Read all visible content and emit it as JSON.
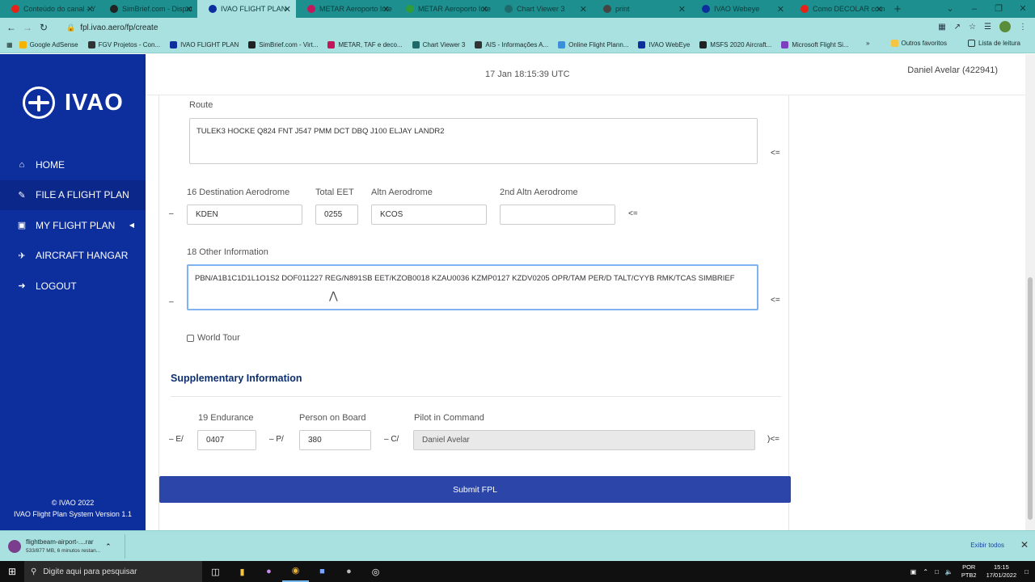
{
  "browser": {
    "tabs": [
      {
        "title": "Conteúdo do canal - Y",
        "color": "#e62117"
      },
      {
        "title": "SimBrief.com - Dispat",
        "color": "#222222"
      },
      {
        "title": "IVAO FLIGHT PLAN",
        "color": "#0d2f9e"
      },
      {
        "title": "METAR Aeroporto Inte",
        "color": "#c2185b"
      },
      {
        "title": "METAR Aeroporto Inte",
        "color": "#2e9d3a"
      },
      {
        "title": "Chart Viewer 3",
        "color": "#1e6a6a"
      },
      {
        "title": "print",
        "color": "#444444"
      },
      {
        "title": "IVAO Webeye",
        "color": "#0d2f9e"
      },
      {
        "title": "Como DECOLAR com",
        "color": "#e62117"
      }
    ],
    "url": "fpl.ivao.aero/fp/create",
    "bookmarks": [
      {
        "label": "Google AdSense",
        "color": "#f4b400"
      },
      {
        "label": "FGV Projetos - Con...",
        "color": "#333333"
      },
      {
        "label": "IVAO FLIGHT PLAN",
        "color": "#0d2f9e"
      },
      {
        "label": "SimBrief.com - Virt...",
        "color": "#222222"
      },
      {
        "label": "METAR, TAF e deco...",
        "color": "#c2185b"
      },
      {
        "label": "Chart Viewer 3",
        "color": "#1e6a6a"
      },
      {
        "label": "AIS - Informações A...",
        "color": "#333333"
      },
      {
        "label": "Online Flight Plann...",
        "color": "#3a8fd8"
      },
      {
        "label": "IVAO WebEye",
        "color": "#0d2f9e"
      },
      {
        "label": "MSFS 2020 Aircraft...",
        "color": "#222222"
      },
      {
        "label": "Microsoft Flight Si...",
        "color": "#7b3fbf"
      }
    ],
    "other_favorites": "Outros favoritos",
    "reading_list": "Lista de leitura"
  },
  "sidebar": {
    "logo_text": "IVAO",
    "items": [
      {
        "label": "HOME",
        "icon": "home-icon"
      },
      {
        "label": "FILE A FLIGHT PLAN",
        "icon": "pencil-icon"
      },
      {
        "label": "MY FLIGHT PLAN",
        "icon": "document-icon"
      },
      {
        "label": "AIRCRAFT HANGAR",
        "icon": "plane-icon"
      },
      {
        "label": "LOGOUT",
        "icon": "logout-icon"
      }
    ],
    "footer_line1": "© IVAO 2022",
    "footer_line2": "IVAO Flight Plan System Version 1.1"
  },
  "header": {
    "clock": "17 Jan 18:15:39 UTC",
    "user": "Daniel Avelar (422941)"
  },
  "form": {
    "route_label": "Route",
    "route_value": "TULEK3 HOCKE Q824 FNT J547 PMM DCT DBQ J100 ELJAY LANDR2",
    "route_arrow": "<=",
    "dest_label": "16 Destination Aerodrome",
    "dest_value": "KDEN",
    "eet_label": "Total EET",
    "eet_value": "0255",
    "altn_label": "Altn Aerodrome",
    "altn_value": "KCOS",
    "altn2_label": "2nd Altn Aerodrome",
    "altn2_value": "",
    "dest_prefix": "–",
    "dest_arrow": "<=",
    "other_label": "18 Other Information",
    "other_value": "PBN/A1B1C1D1L1O1S2 DOF011227 REG/N891SB EET/KZOB0018 KZAU0036 KZMP0127 KZDV0205 OPR/TAM PER/D TALT/CYYB RMK/TCAS SIMBRIEF",
    "other_prefix": "–",
    "other_arrow": "<=",
    "world_tour_label": "World Tour",
    "supp_title": "Supplementary Information",
    "endurance_label": "19 Endurance",
    "endurance_prefix": "– E/",
    "endurance_value": "0407",
    "pob_label": "Person on Board",
    "pob_prefix": "– P/",
    "pob_value": "380",
    "pic_label": "Pilot in Command",
    "pic_prefix": "– C/",
    "pic_value": "Daniel Avelar",
    "pic_suffix": ")<=",
    "submit_label": "Submit FPL"
  },
  "downloads": {
    "file_name": "flightbeam-airport-....rar",
    "file_status": "533/877 MB, 6 minutos restan...",
    "show_all": "Exibir todos"
  },
  "taskbar": {
    "search_placeholder": "Digite aqui para pesquisar",
    "lang_line1": "POR",
    "lang_line2": "PTB2",
    "time": "15:15",
    "date": "17/01/2022"
  }
}
